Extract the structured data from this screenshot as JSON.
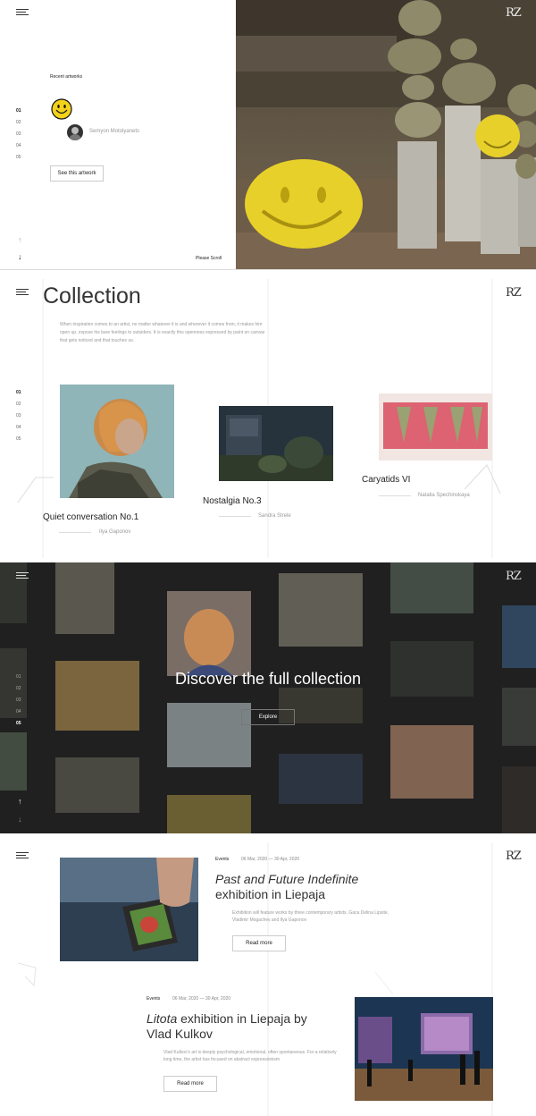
{
  "hero": {
    "recent_label": "Recent artworks",
    "nav_numbers": [
      "01",
      "02",
      "03",
      "04",
      "05"
    ],
    "artist_name": "Semyon Motolyanets",
    "cta_label": "See this artwork",
    "scroll_label": "Please Scroll",
    "arrow_up": "↑",
    "arrow_down": "↓"
  },
  "logo": "RZ",
  "collection": {
    "title": "Collection",
    "intro": "When inspiration comes to an artist, no matter whatever it is and wherever it comes from, it makes him open up, expose his bare feelings to outsiders. It is exactly this openness expressed by paint on canvas that gets noticed and that touches us.",
    "nav_numbers": [
      "01",
      "02",
      "03",
      "04",
      "05"
    ],
    "artworks": [
      {
        "title": "Quiet conversation No.1",
        "author": "Ilya Gaponov"
      },
      {
        "title": "Nostalgia No.3",
        "author": "Sandra Strele"
      },
      {
        "title": "Caryatids VI",
        "author": "Natalia Spechinskaya"
      }
    ]
  },
  "discover": {
    "title": "Discover the full collection",
    "cta_label": "Explore",
    "nav_numbers": [
      "01",
      "02",
      "03",
      "04",
      "05"
    ],
    "arrow_up": "↑",
    "arrow_down": "↓"
  },
  "events": [
    {
      "tag": "Events",
      "date": "06 Mar, 2020 — 30 Apr, 2020",
      "title_italic": "Past and Future Indefinite",
      "title_rest": "exhibition in Liepaja",
      "text": "Exhibition will feature works by three contemporary artists, Gaca Delina Lipsite, Vladimir Mogachev and Ilya Gaponov",
      "cta_label": "Read more"
    },
    {
      "tag": "Events",
      "date": "06 Mar, 2020 — 30 Apr, 2020",
      "title_italic": "Litota",
      "title_rest": "exhibition in Liepaja by Vlad Kulkov",
      "text": "Vlad Kulkov’s art is deeply psychological, emotional, often spontaneous. For a relatively long time, the artist has focused on abstract expressionism",
      "cta_label": "Read more"
    }
  ],
  "colors": {
    "accent_yellow": "#e8d02a",
    "dark_bg": "#202020"
  }
}
